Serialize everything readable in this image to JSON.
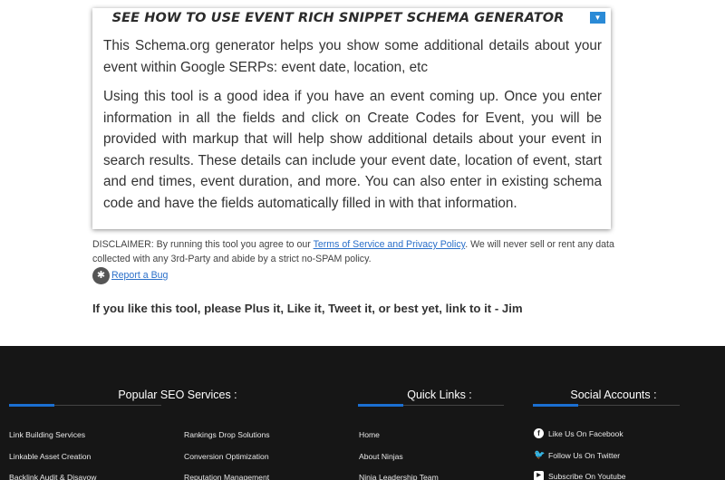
{
  "card": {
    "title": "SEE HOW TO USE EVENT RICH SNIPPET SCHEMA GENERATOR",
    "toggle_icon": "▼",
    "paragraph1": "This Schema.org generator helps you show some additional details about your event within Google SERPs: event date, location, etc",
    "paragraph2": "Using this tool is a good idea if you have an event coming up. Once you enter information in all the fields and click on Create Codes for Event, you will be provided with markup that will help show additional details about your event in search results. These details can include your event date, location of event, start and end times, event duration, and more. You can also enter in existing schema code and have the fields automatically filled in with that information."
  },
  "disclaimer": {
    "prefix": "DISCLAIMER: By running this tool you agree to our ",
    "link": "Terms of Service and Privacy Policy",
    "suffix": ". We will never sell or rent any data collected with any 3rd-Party and abide by a strict no-SPAM policy."
  },
  "bug": {
    "label": "Report a Bug",
    "icon": "bug-icon"
  },
  "cta": "If you like this tool, please Plus it, Like it, Tweet it, or best yet, link to it - Jim",
  "footer": {
    "accent_color": "#1b6fd1",
    "popular": {
      "heading": "Popular SEO Services :",
      "col1": [
        "Link Building Services",
        "Linkable Asset Creation",
        "Backlink Audit & Disavow"
      ],
      "col2": [
        "Rankings Drop Solutions",
        "Conversion Optimization",
        "Reputation Management"
      ]
    },
    "quick": {
      "heading": "Quick Links :",
      "items": [
        "Home",
        "About Ninjas",
        "Ninja Leadership Team"
      ]
    },
    "social": {
      "heading": "Social Accounts :",
      "items": [
        "Like Us On Facebook",
        "Follow Us On Twitter",
        "Subscribe On Youtube"
      ]
    }
  }
}
